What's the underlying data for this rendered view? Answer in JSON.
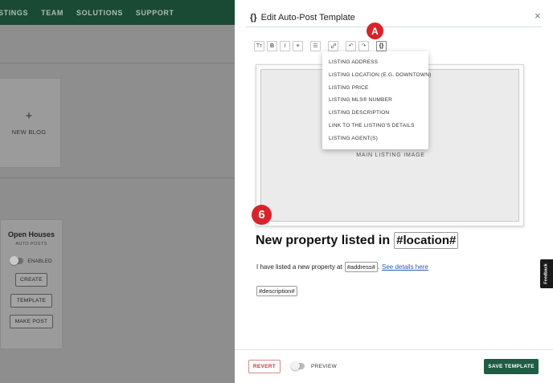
{
  "background": {
    "nav_items": [
      "STINGS",
      "TEAM",
      "SOLUTIONS",
      "SUPPORT"
    ],
    "new_blog": {
      "icon": "plus-icon",
      "label": "NEW BLOG"
    },
    "open_houses": {
      "title": "Open Houses",
      "subtitle": "AUTO POSTS",
      "toggle_label": "ENABLED",
      "buttons": [
        "CREATE",
        "TEMPLATE",
        "MAKE POST"
      ]
    }
  },
  "modal": {
    "title_icon": "{}",
    "title": "Edit Auto-Post Template",
    "close_label": "×",
    "marker_a": "A",
    "marker_6": "6",
    "toolbar": [
      {
        "name": "text-size-icon",
        "glyph": "Tт"
      },
      {
        "name": "bold-icon",
        "glyph": "B"
      },
      {
        "name": "italic-icon",
        "glyph": "I"
      },
      {
        "name": "align-icon",
        "glyph": "≡"
      },
      {
        "name": "list-icon",
        "glyph": "☰"
      },
      {
        "name": "link-icon",
        "glyph": "🔗"
      },
      {
        "name": "undo-icon",
        "glyph": "↶"
      },
      {
        "name": "redo-icon",
        "glyph": "↷"
      },
      {
        "name": "variables-icon",
        "glyph": "{}"
      }
    ],
    "dropdown": [
      "LISTING ADDRESS",
      "LISTING LOCATION (E.G. DOWNTOWN)",
      "LISTING PRICE",
      "LISTING MLS® NUMBER",
      "LISTING DESCRIPTION",
      "LINK TO THE LISTING'S DETAILS",
      "LISTING AGENT(S)"
    ],
    "image_label": "MAIN LISTING IMAGE",
    "headline_text": "New property listed in",
    "headline_tag": "#location#",
    "paragraph_text": "I have listed a new property at",
    "paragraph_tag": "#address#",
    "paragraph_sep": ".",
    "paragraph_link": "See details here",
    "description_tag": "#description#",
    "footer": {
      "revert": "REVERT",
      "preview": "PREVIEW",
      "save": "SAVE TEMPLATE"
    }
  },
  "feedback_tab": "Feedback"
}
